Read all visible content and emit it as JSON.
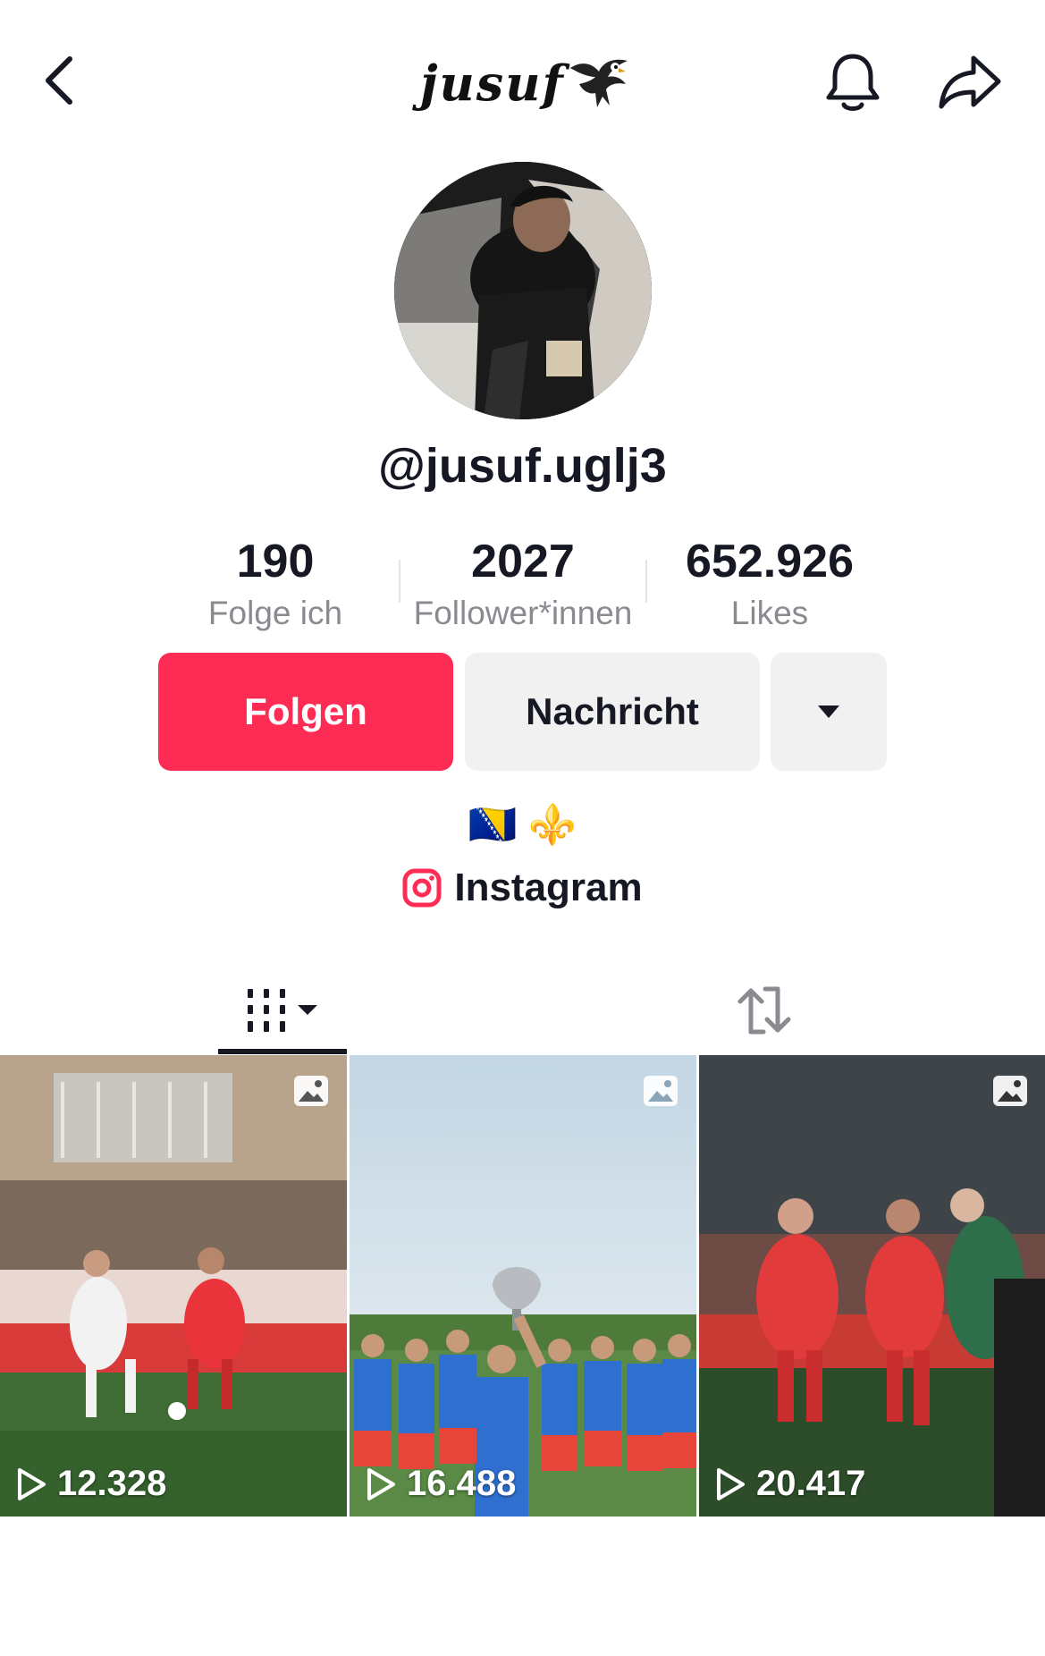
{
  "header": {
    "brand_text": "jusuf",
    "back_icon": "chevron-left-icon",
    "bell_icon": "bell-icon",
    "share_icon": "share-arrow-icon"
  },
  "profile": {
    "username": "@jusuf.uglj3",
    "stats": [
      {
        "value": "190",
        "label": "Folge ich"
      },
      {
        "value": "2027",
        "label": "Follower*innen"
      },
      {
        "value": "652.926",
        "label": "Likes"
      }
    ],
    "buttons": {
      "follow": "Folgen",
      "message": "Nachricht"
    },
    "bio_emojis": "🇧🇦 ⚜️",
    "instagram_label": "Instagram"
  },
  "colors": {
    "accent": "#fe2c55",
    "secondary_button": "#f1f1f2",
    "text": "#161823",
    "muted": "#8a8b91"
  },
  "tabs": [
    {
      "name": "posts",
      "icon": "grid-icon",
      "active": true
    },
    {
      "name": "reposts",
      "icon": "repost-icon",
      "active": false
    }
  ],
  "videos": [
    {
      "views": "12.328"
    },
    {
      "views": "16.488"
    },
    {
      "views": "20.417"
    }
  ]
}
